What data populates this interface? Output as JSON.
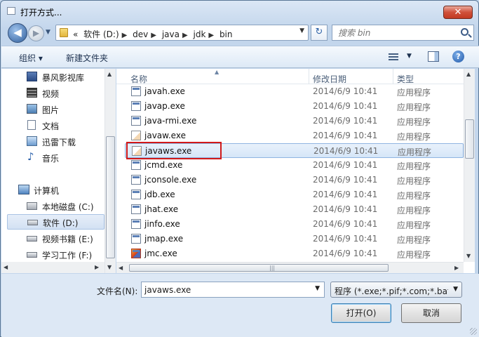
{
  "window": {
    "title": "打开方式..."
  },
  "nav": {
    "back": "◀",
    "forward": "▶",
    "breadcrumbs": [
      "«",
      "软件 (D:)",
      "dev",
      "java",
      "jdk",
      "bin"
    ],
    "search_placeholder": "搜索 bin"
  },
  "toolbar": {
    "organize": "组织 ▾",
    "new_folder": "新建文件夹"
  },
  "sidebar": {
    "items": [
      {
        "label": "暴风影视库",
        "icon": "video-library-icon"
      },
      {
        "label": "视频",
        "icon": "film-icon"
      },
      {
        "label": "图片",
        "icon": "picture-icon"
      },
      {
        "label": "文档",
        "icon": "document-icon"
      },
      {
        "label": "迅雷下载",
        "icon": "download-icon"
      },
      {
        "label": "音乐",
        "icon": "music-icon"
      },
      {
        "label": "计算机",
        "icon": "computer-icon"
      },
      {
        "label": "本地磁盘 (C:)",
        "icon": "system-drive-icon"
      },
      {
        "label": "软件 (D:)",
        "icon": "drive-icon"
      },
      {
        "label": "视频书籍 (E:)",
        "icon": "drive-icon"
      },
      {
        "label": "学习工作 (F:)",
        "icon": "drive-icon"
      }
    ]
  },
  "columns": {
    "name": "名称",
    "date": "修改日期",
    "type": "类型"
  },
  "files": [
    {
      "name": "javah.exe",
      "date": "2014/6/9 10:41",
      "type": "应用程序"
    },
    {
      "name": "javap.exe",
      "date": "2014/6/9 10:41",
      "type": "应用程序"
    },
    {
      "name": "java-rmi.exe",
      "date": "2014/6/9 10:41",
      "type": "应用程序"
    },
    {
      "name": "javaw.exe",
      "date": "2014/6/9 10:41",
      "type": "应用程序"
    },
    {
      "name": "javaws.exe",
      "date": "2014/6/9 10:41",
      "type": "应用程序"
    },
    {
      "name": "jcmd.exe",
      "date": "2014/6/9 10:41",
      "type": "应用程序"
    },
    {
      "name": "jconsole.exe",
      "date": "2014/6/9 10:41",
      "type": "应用程序"
    },
    {
      "name": "jdb.exe",
      "date": "2014/6/9 10:41",
      "type": "应用程序"
    },
    {
      "name": "jhat.exe",
      "date": "2014/6/9 10:41",
      "type": "应用程序"
    },
    {
      "name": "jinfo.exe",
      "date": "2014/6/9 10:41",
      "type": "应用程序"
    },
    {
      "name": "jmap.exe",
      "date": "2014/6/9 10:41",
      "type": "应用程序"
    },
    {
      "name": "jmc.exe",
      "date": "2014/6/9 10:41",
      "type": "应用程序"
    }
  ],
  "bottom": {
    "filename_label": "文件名(N):",
    "filename_value": "javaws.exe",
    "filter_value": "程序 (*.exe;*.pif;*.com;*.bat;*.",
    "open_label": "打开(O)",
    "cancel_label": "取消"
  }
}
